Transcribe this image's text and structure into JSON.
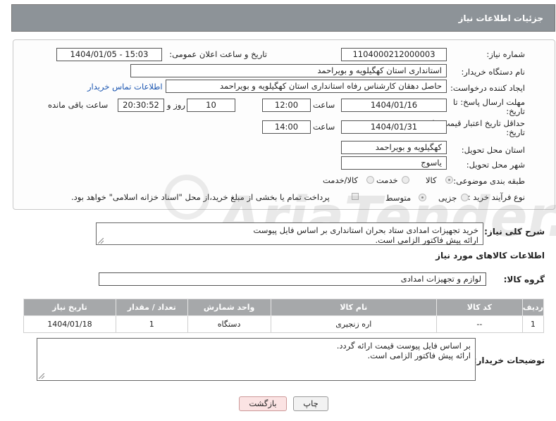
{
  "header": {
    "title": "جزئیات اطلاعات نیاز"
  },
  "fields": {
    "need_number_label": "شماره نیاز:",
    "need_number": "1104000212000003",
    "announce_label": "تاریخ و ساعت اعلان عمومی:",
    "announce_value": "1404/01/05 - 15:03",
    "buyer_org_label": "نام دستگاه خریدار:",
    "buyer_org": "استانداری استان کهگیلویه و بویراحمد",
    "creator_label": "ایجاد کننده درخواست:",
    "creator": "حاصل دهقان کارشناس رفاه استانداری استان کهگیلویه و بویراحمد",
    "contact_link": "اطلاعات تماس خریدار",
    "deadline_label_1": "مهلت ارسال پاسخ: تا",
    "deadline_label_2": "تاریخ:",
    "deadline_date": "1404/01/16",
    "time_label": "ساعت",
    "deadline_time": "12:00",
    "days_value": "10",
    "days_label": "روز و",
    "remaining_time": "20:30:52",
    "remaining_label": "ساعت باقی مانده",
    "validity_label_1": "حداقل تاریخ اعتبار قیمت: تا",
    "validity_label_2": "تاریخ:",
    "validity_date": "1404/01/31",
    "validity_time_label": "ساعت",
    "validity_time": "14:00",
    "province_label": "استان محل تحویل:",
    "province": "کهگیلویه و بویراحمد",
    "city_label": "شهر محل تحویل:",
    "city": "یاسوج",
    "category_label": "طبقه بندی موضوعی:",
    "category_options": [
      "کالا",
      "خدمت",
      "کالا/خدمت"
    ],
    "category_selected": "کالا",
    "process_label": "نوع فرآیند خرید :",
    "process_options": [
      "جزیی",
      "متوسط"
    ],
    "payment_note": "پرداخت تمام یا بخشی از مبلغ خرید،از محل \"اسناد خزانه اسلامی\" خواهد بود."
  },
  "description": {
    "label": "شرح کلی نیاز:",
    "line1": "خرید تجهیزات امدادی ستاد بحران استانداری بر اساس فایل پیوست",
    "line2": "ارائه پیش فاکتور الزامی است."
  },
  "goods_section": {
    "title": "اطلاعات کالاهای مورد نیاز",
    "group_label": "گروه کالا:",
    "group_value": "لوازم و تجهیزات امدادی"
  },
  "table": {
    "headers": [
      "ردیف",
      "کد کالا",
      "نام کالا",
      "واحد شمارش",
      "تعداد / مقدار",
      "تاریخ نیاز"
    ],
    "rows": [
      [
        "1",
        "--",
        "اره زنجیری",
        "دستگاه",
        "1",
        "1404/01/18"
      ]
    ]
  },
  "buyer_notes": {
    "label": "توضیحات خریدار:",
    "line1": "بر اساس فایل پیوست قیمت ارائه گردد.",
    "line2": "ارائه پیش فاکتور الزامی است."
  },
  "buttons": {
    "print": "چاپ",
    "back": "بازگشت"
  },
  "watermark": {
    "text": "AriaTender.net"
  }
}
